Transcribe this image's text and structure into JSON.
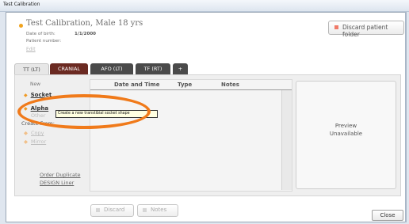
{
  "window": {
    "title": "Test Calibration"
  },
  "patient": {
    "name": "Test Calibration, Male 18 yrs",
    "dob_label": "Date of birth:",
    "dob_value": "1/1/2000",
    "number_label": "Patient number:",
    "edit": "Edit"
  },
  "discard_folder": {
    "label": "Discard patient folder"
  },
  "tabs": [
    {
      "label": "TT (LT)"
    },
    {
      "label": "CRANIAL"
    },
    {
      "label": "AFO (LT)"
    },
    {
      "label": "TF (RT)"
    },
    {
      "label": "+"
    }
  ],
  "sidebar": {
    "new_label": "New",
    "socket": "Socket",
    "alpha": "Alpha",
    "other": "Other",
    "create_from": "Create From:",
    "copy": "Copy",
    "mirror": "Mirror",
    "order_line1": "Order Duplicate",
    "order_line2": "DESIGN Liner"
  },
  "list": {
    "columns": [
      "Date and Time",
      "Type",
      "Notes"
    ]
  },
  "preview": {
    "line1": "Preview",
    "line2": "Unavailable"
  },
  "buttons": {
    "discard": "Discard",
    "notes": "Notes",
    "close": "Close"
  },
  "tooltip": {
    "text": "Create a new transtibial socket shape"
  },
  "colors": {
    "accent_orange": "#f07a1a",
    "cranial_tab": "#6b2a22",
    "tab_dark": "#4a4a4a"
  }
}
